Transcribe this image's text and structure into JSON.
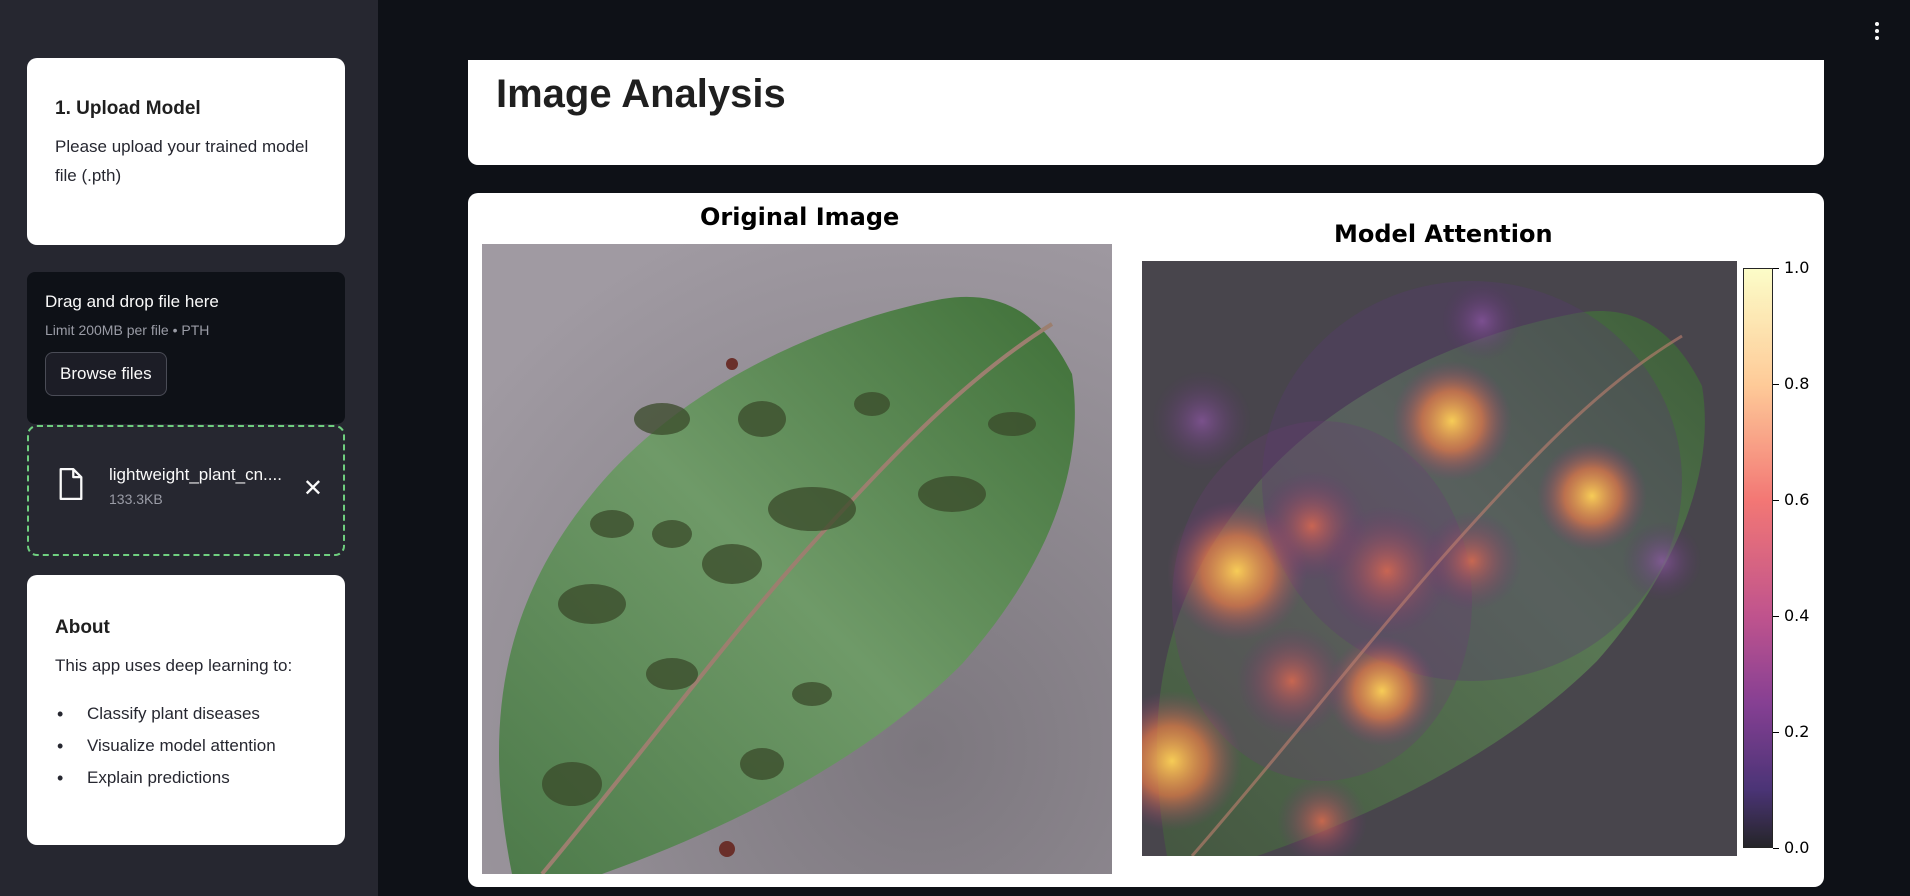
{
  "sidebar": {
    "upload_card": {
      "title": "1. Upload Model",
      "text": "Please upload your trained model file (.pth)"
    },
    "dropzone": {
      "title": "Drag and drop file here",
      "limit": "Limit 200MB per file • PTH",
      "browse_label": "Browse files"
    },
    "uploaded_file": {
      "name": "lightweight_plant_cnn.pth",
      "size": "133.3KB"
    },
    "about": {
      "title": "About",
      "text": "This app uses deep learning to:",
      "items": [
        "Classify plant diseases",
        "Visualize model attention",
        "Explain predictions"
      ]
    }
  },
  "main": {
    "title": "Image Analysis",
    "figure": {
      "left_title": "Original Image",
      "right_title": "Model Attention",
      "colorbar_ticks": [
        "1.0",
        "0.8",
        "0.6",
        "0.4",
        "0.2",
        "0.0"
      ]
    }
  },
  "colors": {
    "sidebar_bg": "#262730",
    "main_bg": "#0e1117",
    "file_border": "#6fcf7f"
  },
  "icons": [
    "file-icon",
    "close-icon",
    "more-menu-icon"
  ]
}
